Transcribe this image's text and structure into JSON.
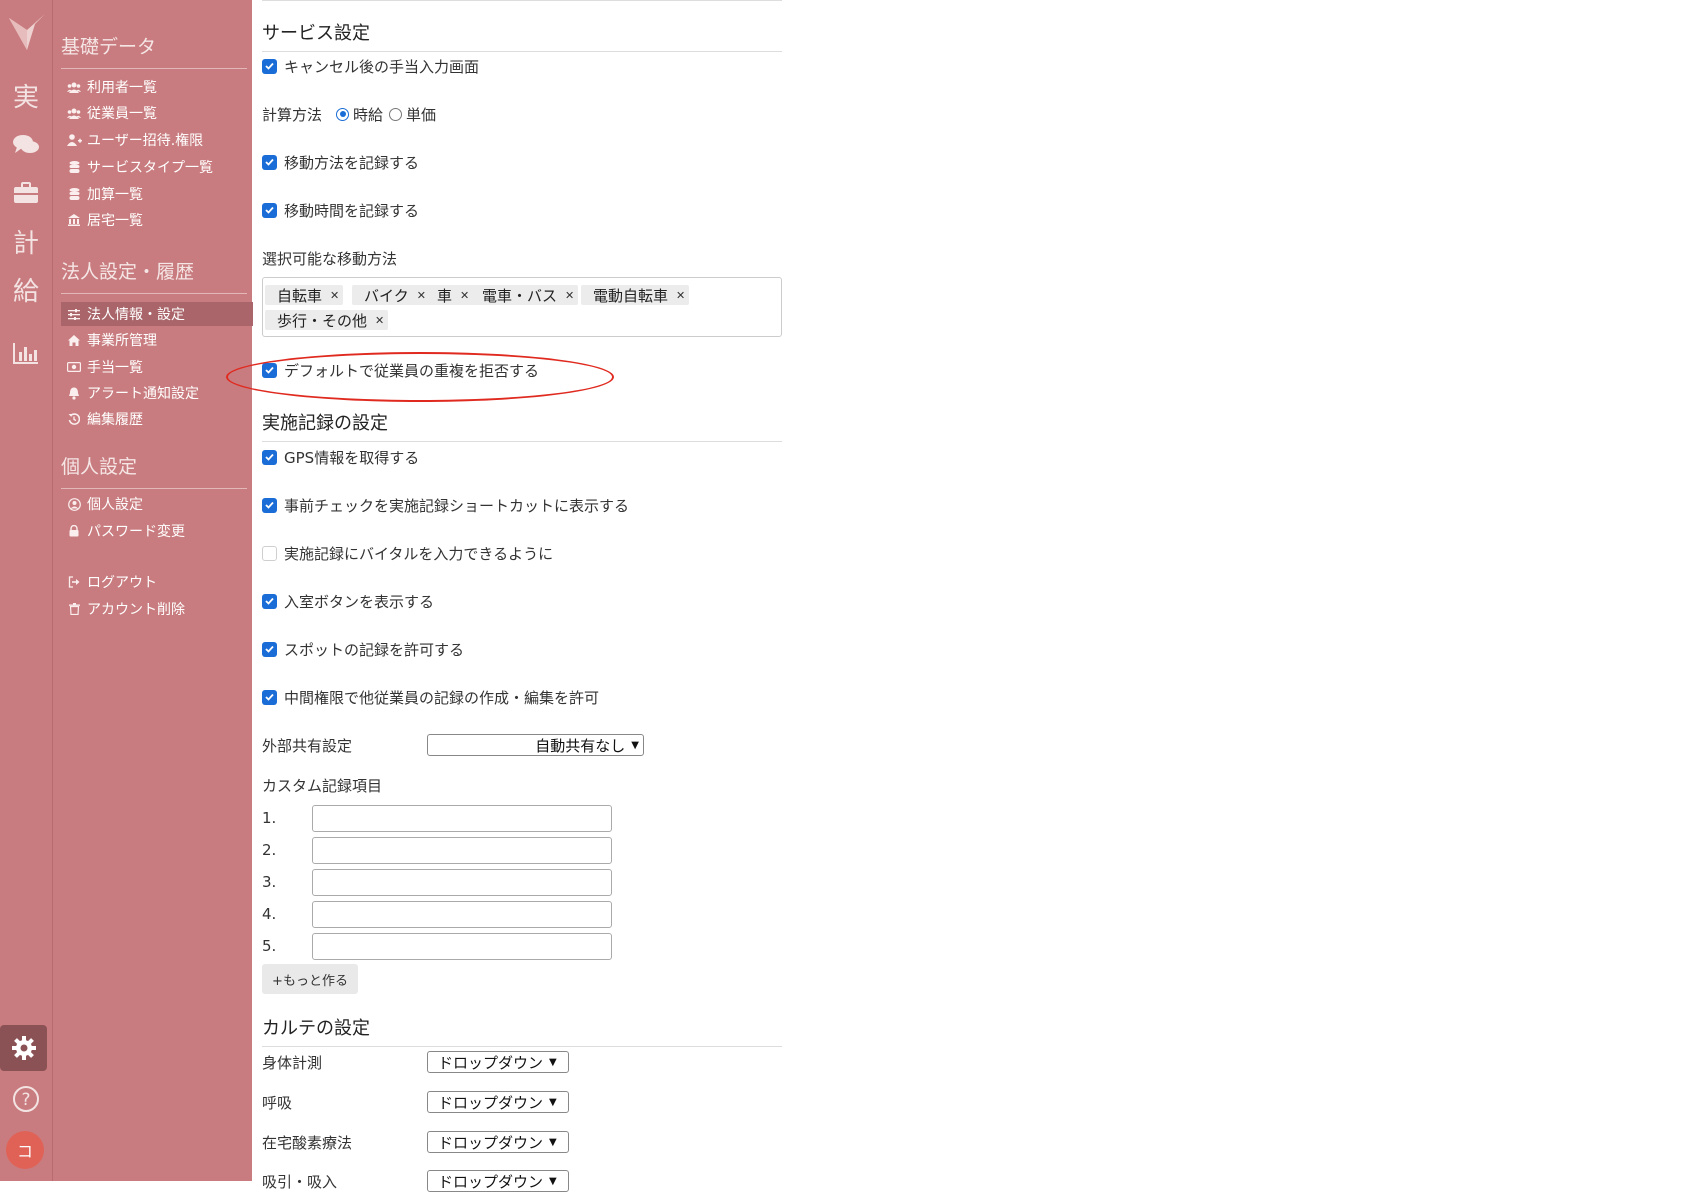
{
  "rail": {
    "items": [
      {
        "name": "records",
        "glyph": "実"
      },
      {
        "name": "chat",
        "icon": "chat-icon"
      },
      {
        "name": "work",
        "icon": "briefcase-icon"
      },
      {
        "name": "plan",
        "glyph": "計"
      },
      {
        "name": "pay",
        "glyph": "給"
      },
      {
        "name": "stats",
        "icon": "bar-chart-icon"
      }
    ],
    "avatar_initial": "コ"
  },
  "sidebar": {
    "sections": [
      {
        "title": "基礎データ"
      },
      {
        "title": "法人設定・履歴"
      },
      {
        "title": "個人設定"
      }
    ],
    "items": [
      {
        "label": "利用者一覧",
        "icon": "users-icon"
      },
      {
        "label": "従業員一覧",
        "icon": "users-icon"
      },
      {
        "label": "ユーザー招待.権限",
        "icon": "user-plus-icon"
      },
      {
        "label": "サービスタイプ一覧",
        "icon": "database-icon"
      },
      {
        "label": "加算一覧",
        "icon": "database-icon"
      },
      {
        "label": "居宅一覧",
        "icon": "building-icon"
      },
      {
        "label": "法人情報・設定",
        "icon": "sliders-icon",
        "active": true
      },
      {
        "label": "事業所管理",
        "icon": "home-icon"
      },
      {
        "label": "手当一覧",
        "icon": "money-icon"
      },
      {
        "label": "アラート通知設定",
        "icon": "bell-icon"
      },
      {
        "label": "編集履歴",
        "icon": "history-icon"
      },
      {
        "label": "個人設定",
        "icon": "user-circle-icon"
      },
      {
        "label": "パスワード変更",
        "icon": "lock-icon"
      },
      {
        "label": "ログアウト",
        "icon": "logout-icon"
      },
      {
        "label": "アカウント削除",
        "icon": "trash-icon"
      }
    ]
  },
  "service": {
    "title": "サービス設定",
    "cancel_allowance": {
      "label": "キャンセル後の手当入力画面",
      "checked": true
    },
    "calc_method": {
      "label": "計算方法",
      "options": [
        "時給",
        "単価"
      ],
      "selected": "時給"
    },
    "record_transport": {
      "label": "移動方法を記録する",
      "checked": true
    },
    "record_travel_time": {
      "label": "移動時間を記録する",
      "checked": true
    },
    "transport_label": "選択可能な移動方法",
    "transport_tags": [
      "自転車",
      "バイク",
      "車",
      "電車・バス",
      "電動自転車",
      "歩行・その他"
    ],
    "reject_duplicate": {
      "label": "デフォルトで従業員の重複を拒否する",
      "checked": true
    }
  },
  "record": {
    "title": "実施記録の設定",
    "options": [
      {
        "label": "GPS情報を取得する",
        "checked": true
      },
      {
        "label": "事前チェックを実施記録ショートカットに表示する",
        "checked": true
      },
      {
        "label": "実施記録にバイタルを入力できるように",
        "checked": false
      },
      {
        "label": "入室ボタンを表示する",
        "checked": true
      },
      {
        "label": "スポットの記録を許可する",
        "checked": true
      },
      {
        "label": "中間権限で他従業員の記録の作成・編集を許可",
        "checked": true
      }
    ],
    "external_share": {
      "label": "外部共有設定",
      "value": "自動共有なし"
    },
    "custom_title": "カスタム記録項目",
    "custom_fields": [
      {
        "num": "1.",
        "value": ""
      },
      {
        "num": "2.",
        "value": ""
      },
      {
        "num": "3.",
        "value": ""
      },
      {
        "num": "4.",
        "value": ""
      },
      {
        "num": "5.",
        "value": ""
      }
    ],
    "more_button": "+もっと作る"
  },
  "karte": {
    "title": "カルテの設定",
    "rows": [
      {
        "label": "身体計測",
        "value": "ドロップダウン"
      },
      {
        "label": "呼吸",
        "value": "ドロップダウン"
      },
      {
        "label": "在宅酸素療法",
        "value": "ドロップダウン"
      },
      {
        "label": "吸引・吸入",
        "value": "ドロップダウン"
      }
    ]
  },
  "colors": {
    "sidebar": "#c97c7f",
    "accent": "#1a6cd6",
    "highlight": "#e02a1f"
  }
}
